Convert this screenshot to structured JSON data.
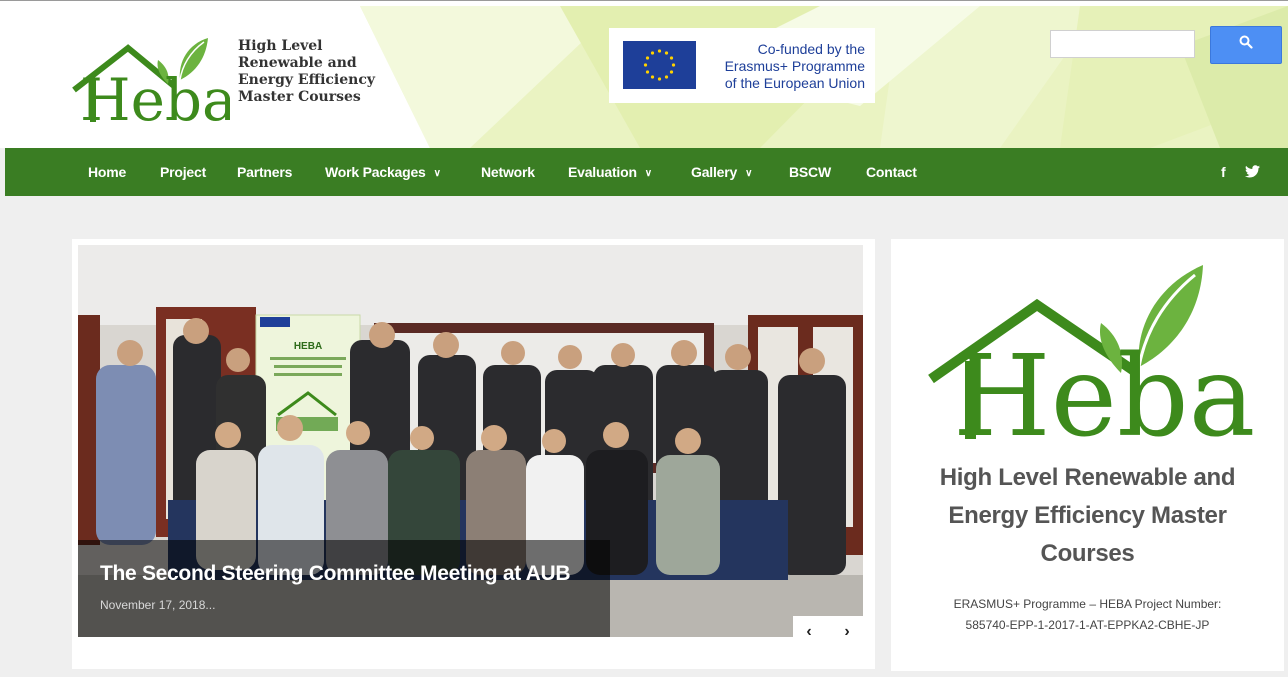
{
  "header": {
    "logo_word": "Heba",
    "logo_lines": [
      "High Level",
      "Renewable and",
      "Energy Efficiency",
      "Master Courses"
    ],
    "eu_lines": [
      "Co-funded by the",
      "Erasmus+ Programme",
      "of the European Union"
    ],
    "search": {
      "placeholder": ""
    }
  },
  "nav": {
    "items": [
      {
        "label": "Home",
        "dropdown": false
      },
      {
        "label": "Project",
        "dropdown": false
      },
      {
        "label": "Partners",
        "dropdown": false
      },
      {
        "label": "Work Packages",
        "dropdown": true
      },
      {
        "label": "Network",
        "dropdown": false
      },
      {
        "label": "Evaluation",
        "dropdown": true
      },
      {
        "label": "Gallery",
        "dropdown": true
      },
      {
        "label": "BSCW",
        "dropdown": false
      },
      {
        "label": "Contact",
        "dropdown": false
      }
    ],
    "social": {
      "facebook": "f",
      "twitter": "twitter-icon"
    }
  },
  "slider": {
    "title": "The Second Steering Committee Meeting at AUB",
    "date": "November 17, 2018...",
    "banner_title": "HEBA",
    "prev_glyph": "‹",
    "next_glyph": "›"
  },
  "sidebar": {
    "logo_word": "Heba",
    "title_lines": [
      "High Level Renewable and",
      "Energy Efficiency Master",
      "Courses"
    ],
    "sub_lines": [
      "ERASMUS+ Programme – HEBA Project Number:",
      "585740-EPP-1-2017-1-AT-EPPKA2-CBHE-JP"
    ]
  },
  "colors": {
    "nav_green": "#3a7d23",
    "logo_green": "#3d8a1c",
    "leaf_green": "#6cb33f",
    "eu_blue": "#1e3f99",
    "search_blue": "#4d8ff4"
  }
}
